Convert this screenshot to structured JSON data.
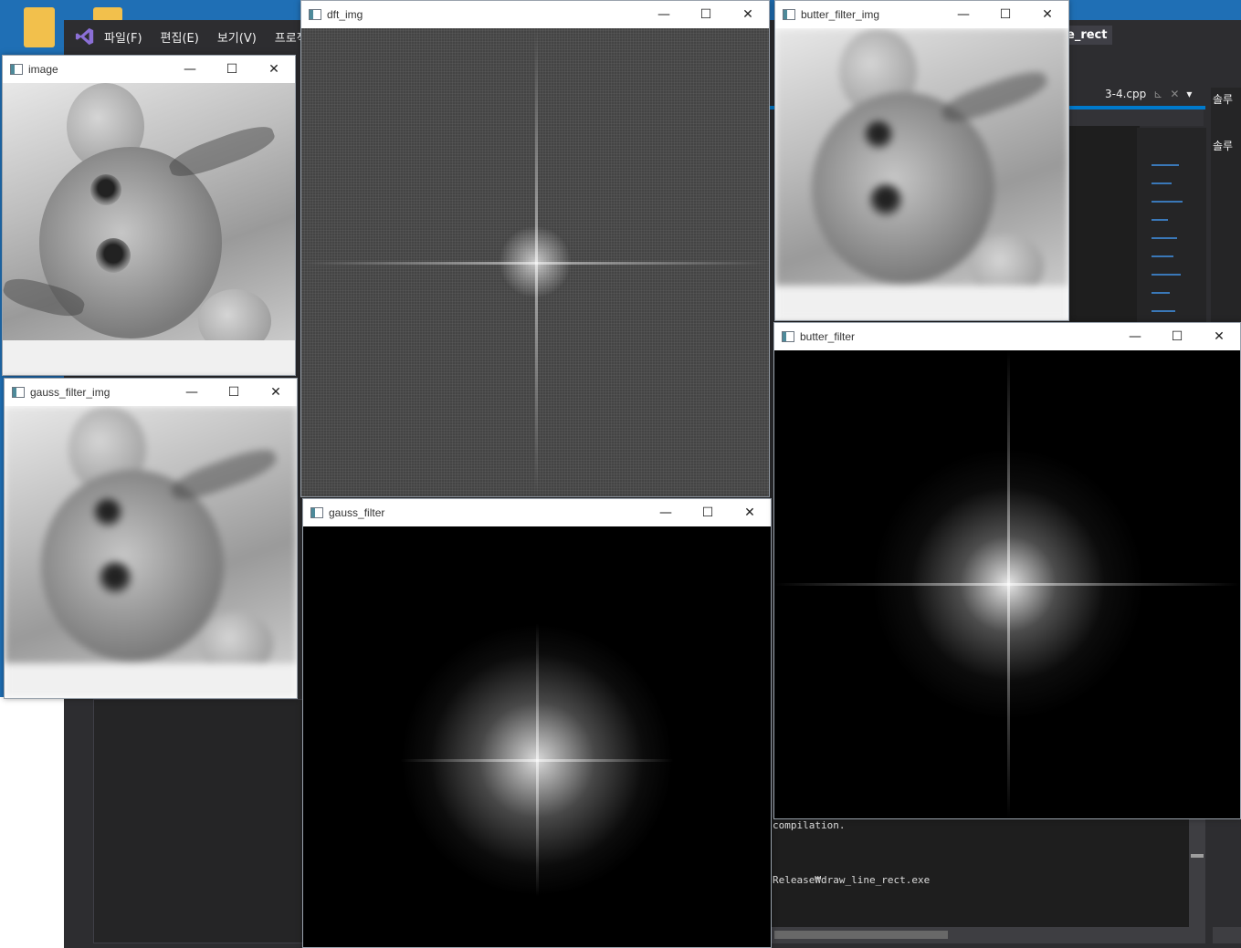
{
  "vs": {
    "menu": [
      "파일(F)",
      "편집(E)",
      "보기(V)",
      "프로젝"
    ],
    "title_fragment": "e_rect",
    "tab_label": "3-4.cpp",
    "tab_pin": "⊾",
    "tab_close": "✕",
    "tab_dropdown": "▾",
    "solution": [
      "솔루",
      "솔루"
    ],
    "output_line1": "compilation.",
    "output_line2": "Release₩draw_line_rect.exe"
  },
  "windows": {
    "image": {
      "title": "image"
    },
    "gauss_filter_img": {
      "title": "gauss_filter_img"
    },
    "dft_img": {
      "title": "dft_img"
    },
    "gauss_filter": {
      "title": "gauss_filter"
    },
    "butter_filter_img": {
      "title": "butter_filter_img"
    },
    "butter_filter": {
      "title": "butter_filter"
    }
  },
  "controls": {
    "minimize": "—",
    "maximize": "☐",
    "close": "✕"
  }
}
